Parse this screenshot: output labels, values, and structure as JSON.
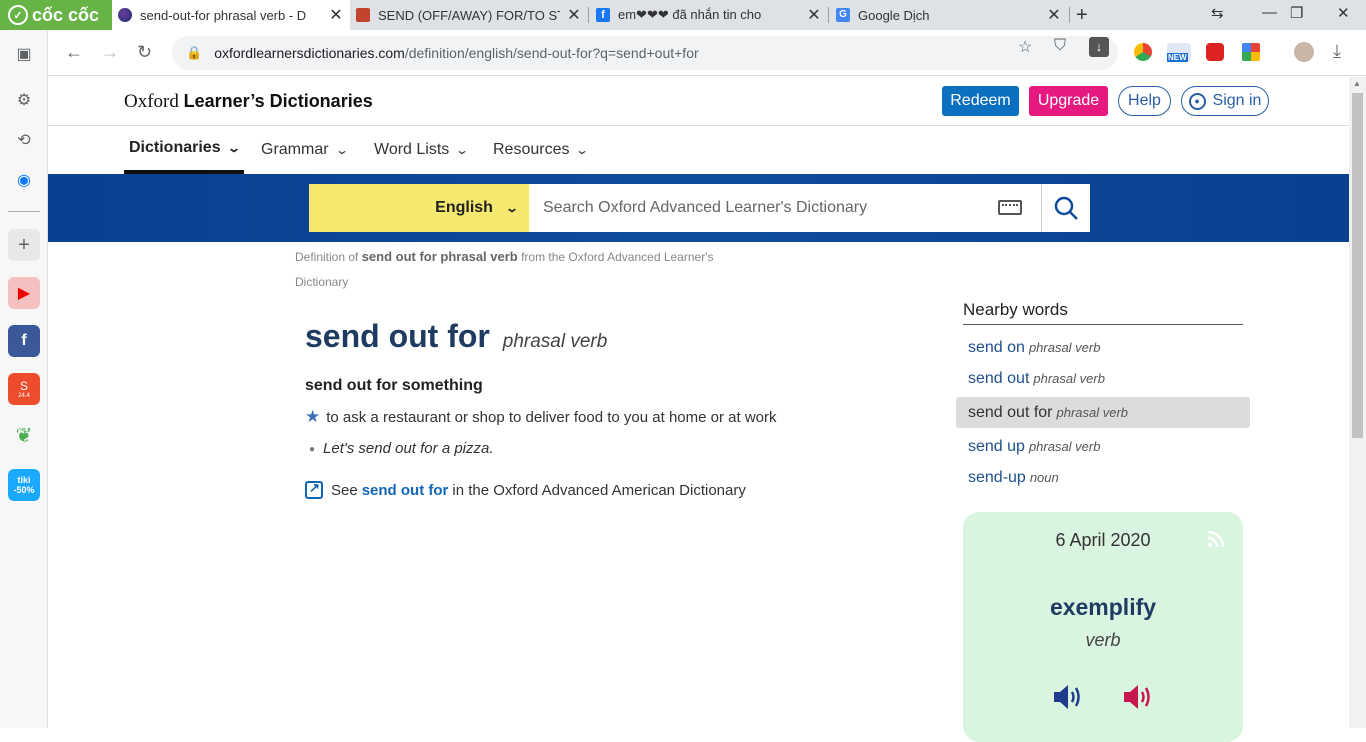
{
  "browser": {
    "brand": "cốc cốc",
    "tabs": [
      {
        "title": "send-out-for phrasal verb - D",
        "active": true
      },
      {
        "title": "SEND (OFF/AWAY) FOR/TO ST",
        "active": false
      },
      {
        "title": "em❤❤❤ đã nhắn tin cho",
        "active": false
      },
      {
        "title": "Google Dịch",
        "active": false
      }
    ],
    "url_host": "oxfordlearnersdictionaries.com",
    "url_path": "/definition/english/send-out-for?q=send+out+for",
    "ext_badge": "NEW",
    "sidebar_shopee_badge": "24.4",
    "sidebar_tiki_label": "tiki",
    "sidebar_tiki_badge": "-50%"
  },
  "header": {
    "logo_plain": "Oxford ",
    "logo_bold": "Learner’s Dictionaries",
    "redeem": "Redeem",
    "upgrade": "Upgrade",
    "help": "Help",
    "sign_in": "Sign in"
  },
  "nav": {
    "items": [
      "Dictionaries",
      "Grammar",
      "Word Lists",
      "Resources"
    ]
  },
  "search": {
    "language": "English",
    "placeholder": "Search Oxford Advanced Learner's Dictionary"
  },
  "entry": {
    "breadcrumb_prefix": "Definition of ",
    "breadcrumb_bold": "send out for phrasal verb",
    "breadcrumb_suffix": " from the Oxford Advanced Learner's Dictionary",
    "headword": "send out for",
    "pos": "phrasal verb",
    "sense_head": "send out for something",
    "definition": "to ask a restaurant or shop to deliver food to you at home or at work",
    "example": "Let's send out for a pizza.",
    "see_prefix": "See",
    "see_link": "send out for",
    "see_suffix": "in the Oxford Advanced American Dictionary"
  },
  "nearby": {
    "title": "Nearby words",
    "items": [
      {
        "word": "send on",
        "pos": "phrasal verb"
      },
      {
        "word": "send out",
        "pos": "phrasal verb"
      },
      {
        "word": "send out for",
        "pos": "phrasal verb"
      },
      {
        "word": "send up",
        "pos": "phrasal verb"
      },
      {
        "word": "send-up",
        "pos": "noun"
      }
    ]
  },
  "wotd": {
    "date": "6 April 2020",
    "word": "exemplify",
    "pos": "verb"
  },
  "colors": {
    "brand_green": "#67b346",
    "oxford_blue": "#0e4d9e",
    "language_yellow": "#f4e96e",
    "redeem_blue": "#0b70c0",
    "upgrade_pink": "#e5197f",
    "wotd_green": "#d9f5e0",
    "uk_audio": "#1f3b8c",
    "us_audio": "#c8164e"
  }
}
